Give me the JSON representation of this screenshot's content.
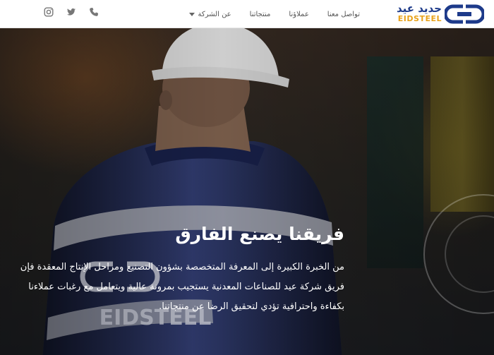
{
  "logo": {
    "arabic": "حديد عيد",
    "english": "EIDSTEEL"
  },
  "nav": {
    "items": [
      {
        "label": "عن الشركة",
        "has_dropdown": true
      },
      {
        "label": "منتجاتنا",
        "has_dropdown": false
      },
      {
        "label": "عملاؤنا",
        "has_dropdown": false
      },
      {
        "label": "تواصل معنا",
        "has_dropdown": false
      }
    ]
  },
  "social": {
    "icons": [
      "phone-icon",
      "twitter-icon",
      "instagram-icon"
    ]
  },
  "hero": {
    "title": "فريقنا يصنع الفارق",
    "paragraph": "من الخبرة الكبيرة إلى المعرفة المتخصصة بشؤون التصنيع ومراحل الإنتاج المعقدة فإن فريق شركة عيد للصناعات المعدنية يستجيب بمرونة عالية ويتعامل مع رغبات عملاءنا بكفاءة واحترافية تؤدي لتحقيق الرضا عن منتجاتنا."
  },
  "colors": {
    "brand_blue": "#1d3a8a",
    "brand_orange": "#e8a21a"
  }
}
